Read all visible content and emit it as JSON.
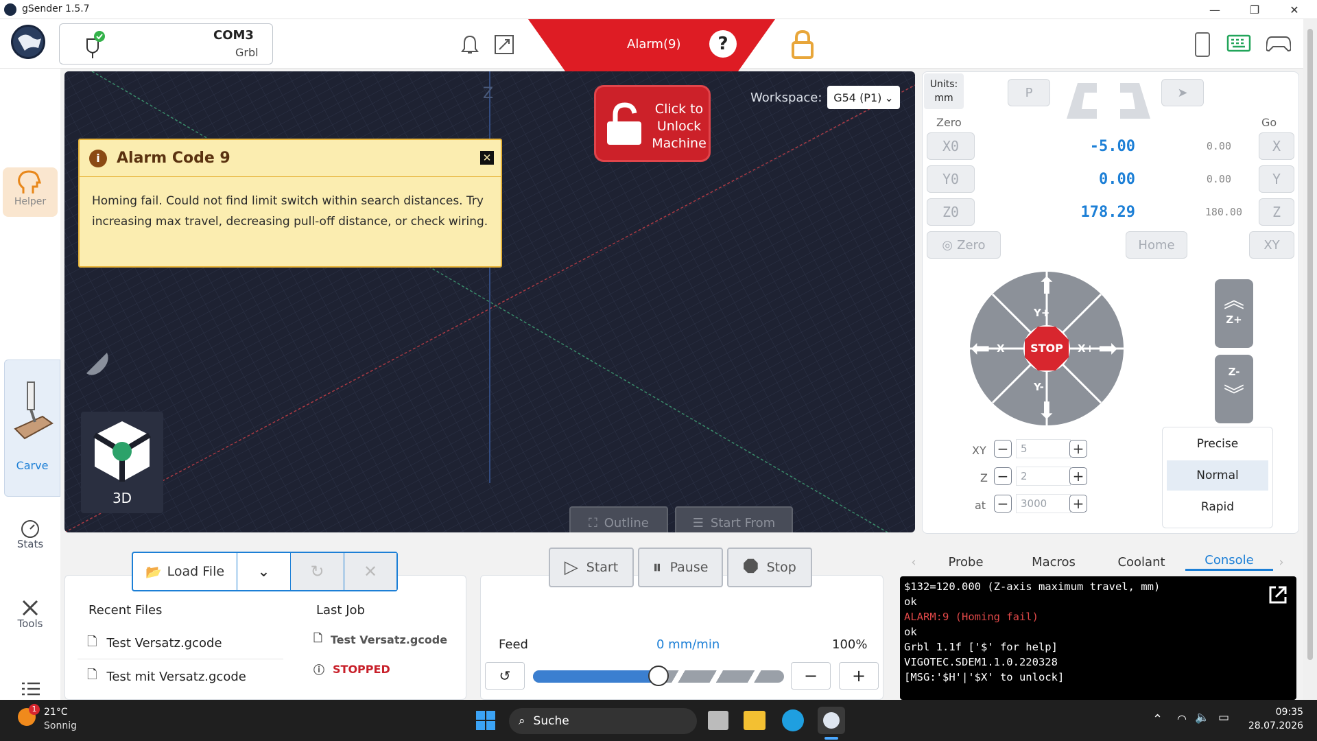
{
  "window": {
    "title": "gSender 1.5.7"
  },
  "header": {
    "port": "COM3",
    "firmware": "Grbl",
    "alarm": "Alarm(9)"
  },
  "sidebar": {
    "helper": "Helper",
    "carve": "Carve",
    "stats": "Stats",
    "tools": "Tools"
  },
  "viewport": {
    "axis_z": "Z",
    "workspace_label": "Workspace:",
    "workspace_value": "G54 (P1)",
    "view_mode": "3D",
    "outline": "Outline",
    "start_from": "Start From"
  },
  "alarm": {
    "title": "Alarm Code 9",
    "message": "Homing fail. Could not find limit switch within search distances. Try increasing max travel, decreasing pull-off distance, or check wiring."
  },
  "unlock": {
    "l1": "Click to",
    "l2": "Unlock",
    "l3": "Machine"
  },
  "dro": {
    "units_label": "Units:",
    "units_value": "mm",
    "probe_btn": "P",
    "zero_label": "Zero",
    "go_label": "Go",
    "rows": [
      {
        "zero": "X0",
        "wpos": "-5.00",
        "mpos": "0.00",
        "go": "X"
      },
      {
        "zero": "Y0",
        "wpos": "0.00",
        "mpos": "0.00",
        "go": "Y"
      },
      {
        "zero": "Z0",
        "wpos": "178.29",
        "mpos": "180.00",
        "go": "Z"
      }
    ],
    "zero_all": "Zero",
    "home": "Home",
    "go_xy": "XY"
  },
  "jog": {
    "yplus": "Y+",
    "yminus": "Y-",
    "xplus": "X+",
    "xminus": "X-",
    "stop": "STOP",
    "zplus": "Z+",
    "zminus": "Z-",
    "xy_label": "XY",
    "xy_value": "5",
    "z_label": "Z",
    "z_value": "2",
    "at_label": "at",
    "at_value": "3000",
    "speeds": [
      "Precise",
      "Normal",
      "Rapid"
    ]
  },
  "files": {
    "load": "Load File",
    "recent_title": "Recent Files",
    "recent": [
      "Test Versatz.gcode",
      "Test mit Versatz.gcode"
    ],
    "last_title": "Last Job",
    "last_file": "Test Versatz.gcode",
    "last_status": "STOPPED"
  },
  "job": {
    "start": "Start",
    "pause": "Pause",
    "stop": "Stop",
    "feed_label": "Feed",
    "feed_value": "0 mm/min",
    "feed_pct": "100%",
    "feed_fraction": 0.5
  },
  "tabs": [
    "Probe",
    "Macros",
    "Coolant",
    "Console"
  ],
  "console": {
    "lines": [
      "$132=120.000 (Z-axis maximum travel, mm)",
      "ok",
      "ALARM:9 (Homing fail)",
      "ok",
      "Grbl 1.1f ['$' for help]",
      "VIGOTEC.SDEM1.1.0.220328",
      "[MSG:'$H'|'$X' to unlock]"
    ]
  },
  "taskbar": {
    "temp": "21°C",
    "weather": "Sonnig",
    "badge": "1",
    "search": "Suche",
    "time": "09:35",
    "date": "28.07.2026"
  },
  "colors": {
    "alarm": "#de1c24",
    "accent": "#1c7fd6",
    "canvas": "#1e2232",
    "warning_bg": "#fbedb0"
  }
}
